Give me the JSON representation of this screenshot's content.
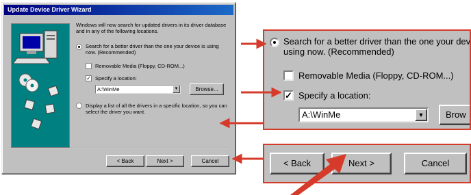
{
  "dialog": {
    "title": "Update Device Driver Wizard",
    "intro": "Windows will now search for updated drivers in its driver database and in any of the following locations.",
    "option_search": "Search for a better driver than the one your device is using now. (Recommended)",
    "option_removable": "Removable Media (Floppy, CD-ROM...)",
    "option_specify": "Specify a location:",
    "location_value": "A:\\WinMe",
    "browse_label": "Browse...",
    "option_display": "Display a list of all the drivers in a specific location, so you can select the driver you want.",
    "back_label": "< Back",
    "next_label": "Next >",
    "cancel_label": "Cancel"
  },
  "zoom_options": {
    "option_search_line1": "Search for a better driver than the one your devi",
    "option_search_line2": "using now. (Recommended)",
    "option_removable": "Removable Media (Floppy, CD-ROM...)",
    "option_specify": "Specify a location:",
    "location_value": "A:\\WinMe",
    "browse_label": "Brow"
  },
  "zoom_buttons": {
    "back_label": "< Back",
    "next_label": "Next >",
    "cancel_label": "Cancel"
  },
  "colors": {
    "callout": "#d63a2a",
    "title_bar": "#000080",
    "dialog_face": "#c0c0c0",
    "art_background": "#008080"
  }
}
